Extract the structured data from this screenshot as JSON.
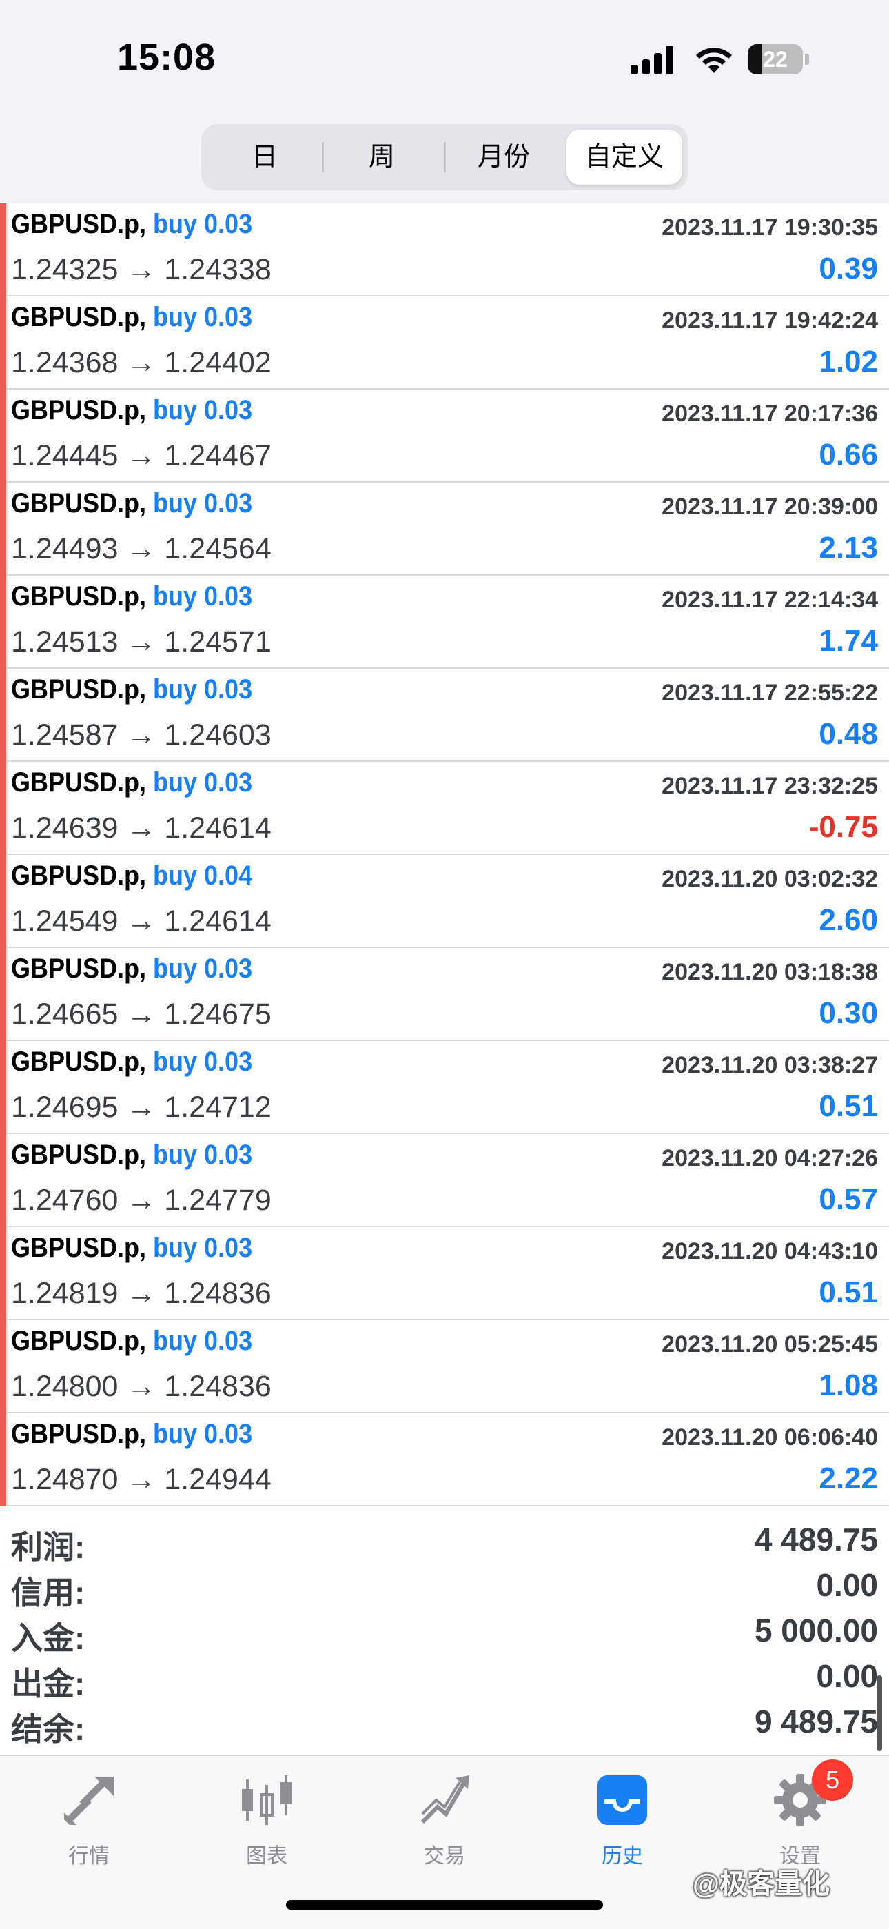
{
  "status": {
    "time": "15:08",
    "battery": "22"
  },
  "segments": [
    {
      "label": "日",
      "active": false
    },
    {
      "label": "周",
      "active": false
    },
    {
      "label": "月份",
      "active": false
    },
    {
      "label": "自定义",
      "active": true
    }
  ],
  "trades": [
    {
      "symbol": "GBPUSD.p,",
      "side": "buy 0.03",
      "prices": "1.24325 → 1.24338",
      "datetime": "2023.11.17 19:30:35",
      "profit": "0.39"
    },
    {
      "symbol": "GBPUSD.p,",
      "side": "buy 0.03",
      "prices": "1.24368 → 1.24402",
      "datetime": "2023.11.17 19:42:24",
      "profit": "1.02"
    },
    {
      "symbol": "GBPUSD.p,",
      "side": "buy 0.03",
      "prices": "1.24445 → 1.24467",
      "datetime": "2023.11.17 20:17:36",
      "profit": "0.66"
    },
    {
      "symbol": "GBPUSD.p,",
      "side": "buy 0.03",
      "prices": "1.24493 → 1.24564",
      "datetime": "2023.11.17 20:39:00",
      "profit": "2.13"
    },
    {
      "symbol": "GBPUSD.p,",
      "side": "buy 0.03",
      "prices": "1.24513 → 1.24571",
      "datetime": "2023.11.17 22:14:34",
      "profit": "1.74"
    },
    {
      "symbol": "GBPUSD.p,",
      "side": "buy 0.03",
      "prices": "1.24587 → 1.24603",
      "datetime": "2023.11.17 22:55:22",
      "profit": "0.48"
    },
    {
      "symbol": "GBPUSD.p,",
      "side": "buy 0.03",
      "prices": "1.24639 → 1.24614",
      "datetime": "2023.11.17 23:32:25",
      "profit": "-0.75"
    },
    {
      "symbol": "GBPUSD.p,",
      "side": "buy 0.04",
      "prices": "1.24549 → 1.24614",
      "datetime": "2023.11.20 03:02:32",
      "profit": "2.60"
    },
    {
      "symbol": "GBPUSD.p,",
      "side": "buy 0.03",
      "prices": "1.24665 → 1.24675",
      "datetime": "2023.11.20 03:18:38",
      "profit": "0.30"
    },
    {
      "symbol": "GBPUSD.p,",
      "side": "buy 0.03",
      "prices": "1.24695 → 1.24712",
      "datetime": "2023.11.20 03:38:27",
      "profit": "0.51"
    },
    {
      "symbol": "GBPUSD.p,",
      "side": "buy 0.03",
      "prices": "1.24760 → 1.24779",
      "datetime": "2023.11.20 04:27:26",
      "profit": "0.57"
    },
    {
      "symbol": "GBPUSD.p,",
      "side": "buy 0.03",
      "prices": "1.24819 → 1.24836",
      "datetime": "2023.11.20 04:43:10",
      "profit": "0.51"
    },
    {
      "symbol": "GBPUSD.p,",
      "side": "buy 0.03",
      "prices": "1.24800 → 1.24836",
      "datetime": "2023.11.20 05:25:45",
      "profit": "1.08"
    },
    {
      "symbol": "GBPUSD.p,",
      "side": "buy 0.03",
      "prices": "1.24870 → 1.24944",
      "datetime": "2023.11.20 06:06:40",
      "profit": "2.22"
    }
  ],
  "summary": [
    {
      "label": "利润:",
      "value": "4 489.75"
    },
    {
      "label": "信用:",
      "value": "0.00"
    },
    {
      "label": "入金:",
      "value": "5 000.00"
    },
    {
      "label": "出金:",
      "value": "0.00"
    },
    {
      "label": "结余:",
      "value": "9 489.75"
    }
  ],
  "tabs": [
    {
      "label": "行情",
      "icon": "quotes-arrows-icon",
      "active": false
    },
    {
      "label": "图表",
      "icon": "candlestick-chart-icon",
      "active": false
    },
    {
      "label": "交易",
      "icon": "trade-trend-icon",
      "active": false
    },
    {
      "label": "历史",
      "icon": "history-inbox-icon",
      "active": true
    },
    {
      "label": "设置",
      "icon": "gear-icon",
      "active": false
    }
  ],
  "settings_badge": "5",
  "watermark": "@极客量化",
  "colors": {
    "accent": "#1680f4",
    "loss": "#e1342a",
    "trade_bar": "#e35d52"
  }
}
